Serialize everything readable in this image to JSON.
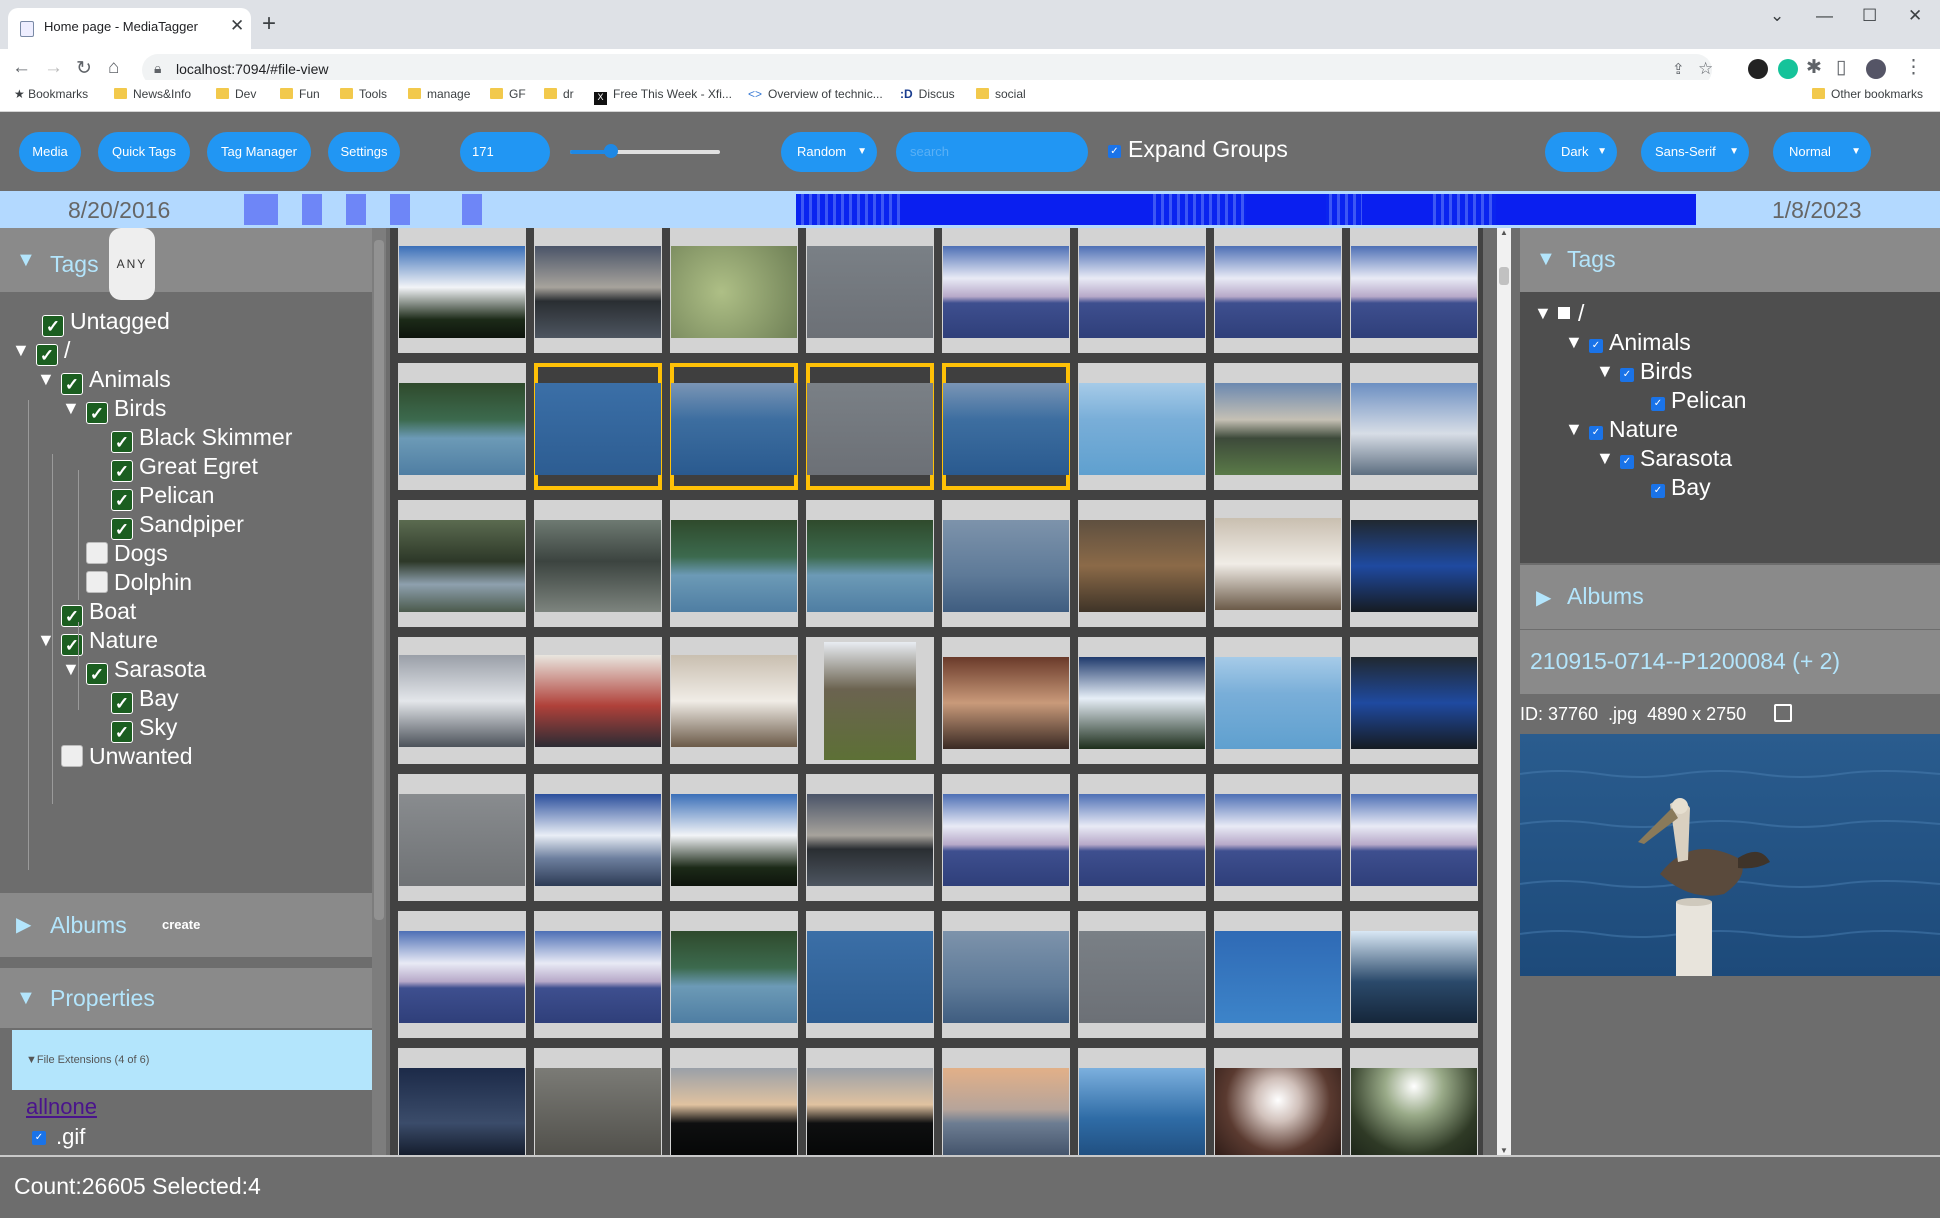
{
  "browser": {
    "tab_title": "Home page - MediaTagger",
    "url": "localhost:7094/#file-view",
    "bookmarks": [
      "Bookmarks",
      "News&Info",
      "Dev",
      "Fun",
      "Tools",
      "manage",
      "GF",
      "dr",
      "Free This Week - Xfi...",
      "Overview of technic...",
      "Discus",
      "social"
    ],
    "other_bookmarks": "Other bookmarks"
  },
  "toolbar": {
    "media": "Media",
    "quick_tags": "Quick Tags",
    "tag_manager": "Tag Manager",
    "settings": "Settings",
    "size_value": "171",
    "sort": "Random",
    "search_placeholder": "search",
    "expand_groups": "Expand Groups",
    "theme": "Dark",
    "font": "Sans-Serif",
    "density": "Normal",
    "thumb_size_level": 0.28
  },
  "timeline": {
    "start": "8/20/2016",
    "end": "1/8/2023"
  },
  "left": {
    "tags_header": "Tags",
    "any_badge": "ANY",
    "tree": [
      {
        "label": "Untagged",
        "checked": true,
        "level": 0,
        "expander": false
      },
      {
        "label": "/",
        "checked": true,
        "level": 0,
        "expander": true
      },
      {
        "label": "Animals",
        "checked": true,
        "level": 1,
        "expander": true
      },
      {
        "label": "Birds",
        "checked": true,
        "level": 2,
        "expander": true
      },
      {
        "label": "Black Skimmer",
        "checked": true,
        "level": 3,
        "expander": false
      },
      {
        "label": "Great Egret",
        "checked": true,
        "level": 3,
        "expander": false
      },
      {
        "label": "Pelican",
        "checked": true,
        "level": 3,
        "expander": false
      },
      {
        "label": "Sandpiper",
        "checked": true,
        "level": 3,
        "expander": false
      },
      {
        "label": "Dogs",
        "checked": false,
        "level": 2,
        "expander": false
      },
      {
        "label": "Dolphin",
        "checked": false,
        "level": 2,
        "expander": false
      },
      {
        "label": "Boat",
        "checked": true,
        "level": 1,
        "expander": false
      },
      {
        "label": "Nature",
        "checked": true,
        "level": 1,
        "expander": true
      },
      {
        "label": "Sarasota",
        "checked": true,
        "level": 2,
        "expander": true
      },
      {
        "label": "Bay",
        "checked": true,
        "level": 3,
        "expander": false
      },
      {
        "label": "Sky",
        "checked": true,
        "level": 3,
        "expander": false
      },
      {
        "label": "Unwanted",
        "checked": false,
        "level": 1,
        "expander": false
      }
    ],
    "albums_header": "Albums",
    "albums_create": "create",
    "properties_header": "Properties",
    "file_ext_header": "File Extensions (4 of 6)",
    "allnone": "allnone",
    "ext_first": ".gif"
  },
  "grid": {
    "selected": [
      9,
      10,
      11,
      12
    ],
    "tiles": [
      "sky-palms",
      "dusk-water",
      "green-ground",
      "gray-water",
      "pink-cloud",
      "pink-cloud",
      "pink-cloud",
      "pink-cloud",
      "dock-water",
      "pelican-post",
      "blue-water",
      "gray-water",
      "blue-water",
      "boat-water",
      "palm-dock",
      "marina",
      "trees-dock",
      "deck",
      "dock-water",
      "dock-water",
      "blue-haze",
      "room",
      "bedroom",
      "dark-screen",
      "plate",
      "people",
      "bedroom",
      "hill",
      "people-group",
      "waterfall",
      "boat-water",
      "dark-screen",
      "gray-ground",
      "blue-cloud",
      "sky-palms",
      "dusk-water",
      "pink-cloud",
      "pink-cloud",
      "pink-cloud",
      "pink-cloud",
      "pink-cloud",
      "pink-cloud",
      "dock-water",
      "pelican-post",
      "blue-haze",
      "gray-water",
      "birds-flying",
      "people-boat",
      "night-lights",
      "sand",
      "dusk-trees",
      "dusk-trees",
      "bridge",
      "sailboats",
      "fence",
      "trees-up"
    ]
  },
  "right": {
    "tags_header": "Tags",
    "tree": [
      {
        "label": "/",
        "level": 0,
        "expander": true
      },
      {
        "label": "Animals",
        "level": 1,
        "expander": true
      },
      {
        "label": "Birds",
        "level": 2,
        "expander": true
      },
      {
        "label": "Pelican",
        "level": 3,
        "expander": false
      },
      {
        "label": "Nature",
        "level": 1,
        "expander": true
      },
      {
        "label": "Sarasota",
        "level": 2,
        "expander": true
      },
      {
        "label": "Bay",
        "level": 3,
        "expander": false
      }
    ],
    "albums_header": "Albums",
    "file_name": "210915-0714--P1200084 (+ 2)",
    "meta": "ID: 37760  .jpg  4890 x 2750"
  },
  "status": "Count:26605 Selected:4",
  "colors": {
    "accent": "#2196f3",
    "selection": "#ffc107",
    "panel": "#6d6d6d",
    "header": "#8a8a8a",
    "header_text": "#b3e5fc"
  }
}
